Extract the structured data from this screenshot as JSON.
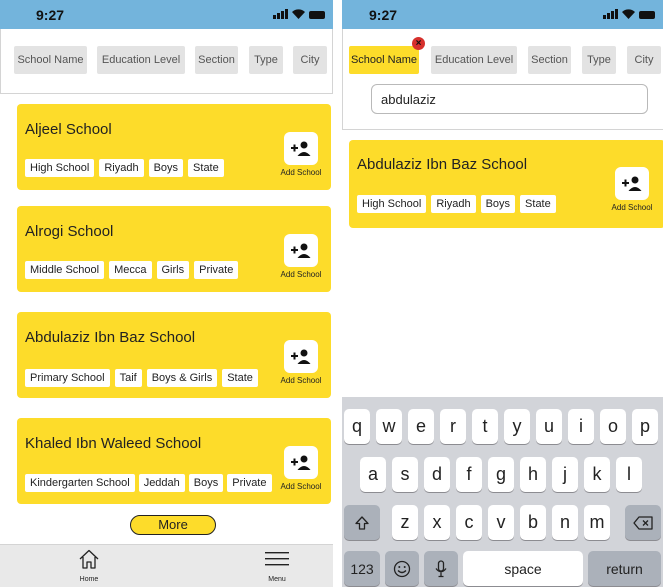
{
  "status": {
    "time": "9:27"
  },
  "filters": {
    "school_name": "School Name",
    "education_level": "Education Level",
    "section": "Section",
    "type": "Type",
    "city": "City"
  },
  "list_screen": {
    "cards": [
      {
        "title": "Aljeel School",
        "tags": [
          "High School",
          "Riyadh",
          "Boys",
          "State"
        ],
        "add_label": "Add School"
      },
      {
        "title": "Alrogi School",
        "tags": [
          "Middle School",
          "Mecca",
          "Girls",
          "Private"
        ],
        "add_label": "Add School"
      },
      {
        "title": "Abdulaziz Ibn Baz School",
        "tags": [
          "Primary School",
          "Taif",
          "Boys & Girls",
          "State"
        ],
        "add_label": "Add School"
      },
      {
        "title": "Khaled Ibn Waleed School",
        "tags": [
          "Kindergarten School",
          "Jeddah",
          "Boys",
          "Private"
        ],
        "add_label": "Add School"
      }
    ],
    "more_label": "More",
    "tabs": {
      "home": "Home",
      "menu": "Menu"
    }
  },
  "search_screen": {
    "close_glyph": "×",
    "search_value": "abdulaziz",
    "result": {
      "title": "Abdulaziz Ibn Baz School",
      "tags": [
        "High School",
        "Riyadh",
        "Boys",
        "State"
      ],
      "add_label": "Add School"
    }
  },
  "keyboard": {
    "row1": [
      "q",
      "w",
      "e",
      "r",
      "t",
      "y",
      "u",
      "i",
      "o",
      "p"
    ],
    "row2": [
      "a",
      "s",
      "d",
      "f",
      "g",
      "h",
      "j",
      "k",
      "l"
    ],
    "row3": [
      "z",
      "x",
      "c",
      "v",
      "b",
      "n",
      "m"
    ],
    "numbers_label": "123",
    "space_label": "space",
    "return_label": "return",
    "icons": {
      "shift": "shift-icon",
      "backspace": "backspace-icon",
      "emoji": "emoji-icon",
      "mic": "microphone-icon"
    }
  },
  "colors": {
    "accent": "#fddc2a",
    "status_bar": "#73b4dc",
    "chip": "#e3e3e3",
    "badge": "#d6302c",
    "keyboard": "#d2d4d9"
  }
}
